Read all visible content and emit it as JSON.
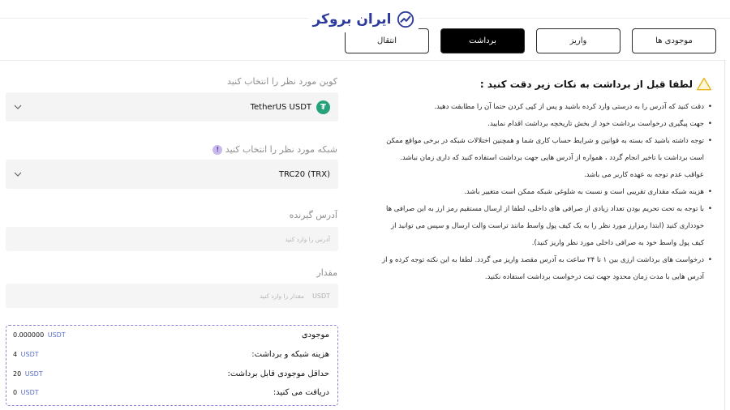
{
  "brand": {
    "logo_text": "ایران بروکر"
  },
  "tabs": [
    {
      "label": "موجودی ها",
      "active": false
    },
    {
      "label": "واریز",
      "active": false
    },
    {
      "label": "برداشت",
      "active": true
    },
    {
      "label": "انتقال",
      "active": false
    }
  ],
  "notes": {
    "title": "لطفا قبل از برداشت به نکات زیر دقت کنید :",
    "items": [
      "دقت کنید که آدرس را به درستی وارد کرده باشید و پس از کپی کردن حتما آن را مطابقت دهید.",
      "جهت پیگیری درخواست برداشت خود از بخش تاریخچه برداشت اقدام نمایید.",
      "توجه داشته باشید که بسته به قوانین و شرایط حساب کاری شما و همچنین اختلالات شبکه در برخی مواقع ممکن است برداشت با تاخیر انجام گردد ، همواره از آدرس هایی جهت برداشت استفاده کنید که داری زمان نباشد. عواقب عدم توجه به عهده کاربر می باشد.",
      "هزینه شبکه مقداری تقریبی است و نسبت به شلوغی شبکه ممکن است متغییر باشد.",
      "با توجه به تحت تحریم بودن تعداد زیادی از صرافی های داخلی، لطفا از ارسال مستقیم رمز ارز به این صرافی ها خودداری کنید (ابتدا رمزارز مورد نظر را به یک کیف پول واسط مانند تراست والت ارسال و سپس می توانید از کیف پول واسط خود به صرافی داخلی مورد نظر واریز کنید).",
      "درخواست های برداشت ارزی بین ۱ تا ۲۴ ساعت به آدرس مقصد واریز می گردد. لطفا به این نکته توجه کرده و از آدرس هایی با مدت زمان محدود جهت ثبت درخواست برداشت استفاده نکنید."
    ]
  },
  "form": {
    "coin_label": "کوین مورد نظر را انتخاب کنید",
    "coin_value": "TetherUS  USDT",
    "coin_icon": "tether-icon",
    "network_label": "شبکه مورد نظر را انتخاب کنید",
    "network_value": "TRC20 (TRX)",
    "address_label": "آدرس گیرنده",
    "address_placeholder": "آدرس را وارد کنید",
    "amount_label": "مقدار",
    "amount_placeholder": "مقدار را وارد کنید",
    "amount_unit": "USDT"
  },
  "summary": [
    {
      "label": "موجودی",
      "value": "0.000000",
      "unit": "USDT"
    },
    {
      "label": "هزینه شبکه و برداشت:",
      "value": "4",
      "unit": "USDT"
    },
    {
      "label": "حداقل موجودی قابل برداشت:",
      "value": "20",
      "unit": "USDT"
    },
    {
      "label": "دریافت می کنید:",
      "value": "0",
      "unit": "USDT"
    }
  ],
  "colors": {
    "accent": "#2b3a9b",
    "tether": "#26a17b",
    "summary_border": "#8d86d6",
    "active_tab": "#000000"
  }
}
